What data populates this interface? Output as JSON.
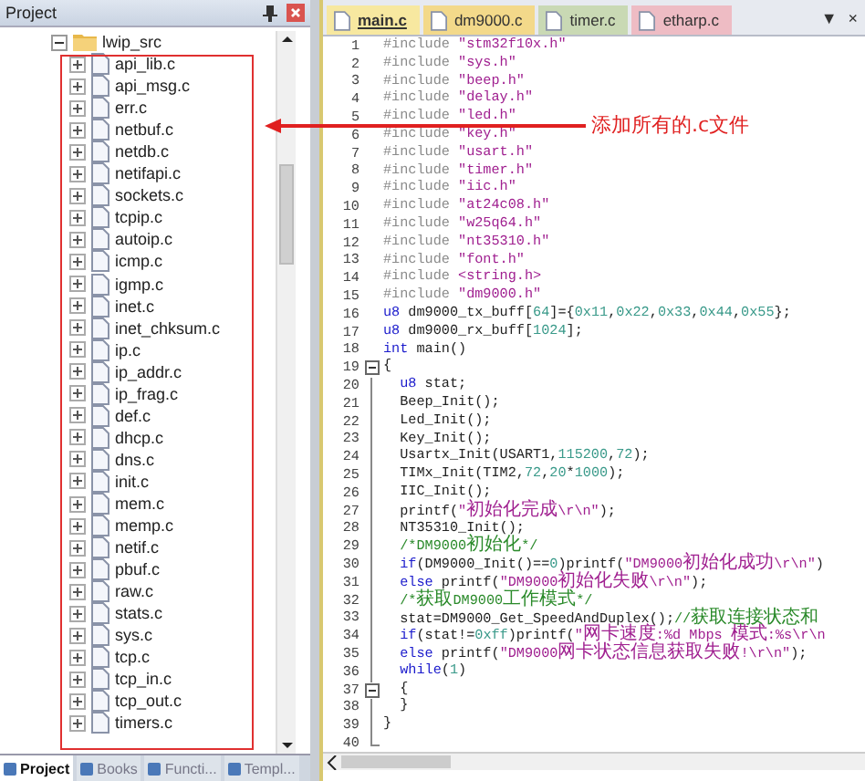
{
  "project_panel": {
    "title": "Project",
    "tree": {
      "label": "lwip_src",
      "expanded": true,
      "children": [
        {
          "label": "api_lib.c"
        },
        {
          "label": "api_msg.c"
        },
        {
          "label": "err.c"
        },
        {
          "label": "netbuf.c"
        },
        {
          "label": "netdb.c"
        },
        {
          "label": "netifapi.c"
        },
        {
          "label": "sockets.c"
        },
        {
          "label": "tcpip.c"
        },
        {
          "label": "autoip.c"
        },
        {
          "label": "icmp.c"
        },
        {
          "label": "igmp.c"
        },
        {
          "label": "inet.c"
        },
        {
          "label": "inet_chksum.c"
        },
        {
          "label": "ip.c"
        },
        {
          "label": "ip_addr.c"
        },
        {
          "label": "ip_frag.c"
        },
        {
          "label": "def.c"
        },
        {
          "label": "dhcp.c"
        },
        {
          "label": "dns.c"
        },
        {
          "label": "init.c"
        },
        {
          "label": "mem.c"
        },
        {
          "label": "memp.c"
        },
        {
          "label": "netif.c"
        },
        {
          "label": "pbuf.c"
        },
        {
          "label": "raw.c"
        },
        {
          "label": "stats.c"
        },
        {
          "label": "sys.c"
        },
        {
          "label": "tcp.c"
        },
        {
          "label": "tcp_in.c"
        },
        {
          "label": "tcp_out.c"
        },
        {
          "label": "timers.c"
        }
      ]
    },
    "bottom_tabs": [
      {
        "label": "Project",
        "selected": true
      },
      {
        "label": "Books",
        "selected": false
      },
      {
        "label": "Functi...",
        "selected": false
      },
      {
        "label": "Templ...",
        "selected": false
      }
    ]
  },
  "annotation": {
    "text": "添加所有的.c文件"
  },
  "editor": {
    "tabs": [
      {
        "label": "main.c",
        "selected": true,
        "color": "#f7e8a0"
      },
      {
        "label": "dm9000.c",
        "selected": false,
        "color": "#f3d98a"
      },
      {
        "label": "timer.c",
        "selected": false,
        "color": "#c9d9b4"
      },
      {
        "label": "etharp.c",
        "selected": false,
        "color": "#eebcc4"
      }
    ],
    "menu_glyph": "▼",
    "close_glyph": "×",
    "lines": [
      {
        "number": "1",
        "tokens": [
          {
            "kind": "directive",
            "text": "#include "
          },
          {
            "kind": "string",
            "text": "\"stm32f10x.h\""
          }
        ]
      },
      {
        "number": "2",
        "tokens": [
          {
            "kind": "directive",
            "text": "#include "
          },
          {
            "kind": "string",
            "text": "\"sys.h\""
          }
        ]
      },
      {
        "number": "3",
        "tokens": [
          {
            "kind": "directive",
            "text": "#include "
          },
          {
            "kind": "string",
            "text": "\"beep.h\""
          }
        ]
      },
      {
        "number": "4",
        "tokens": [
          {
            "kind": "directive",
            "text": "#include "
          },
          {
            "kind": "string",
            "text": "\"delay.h\""
          }
        ]
      },
      {
        "number": "5",
        "tokens": [
          {
            "kind": "directive",
            "text": "#include "
          },
          {
            "kind": "string",
            "text": "\"led.h\""
          }
        ]
      },
      {
        "number": "6",
        "tokens": [
          {
            "kind": "directive",
            "text": "#include "
          },
          {
            "kind": "string",
            "text": "\"key.h\""
          }
        ]
      },
      {
        "number": "7",
        "tokens": [
          {
            "kind": "directive",
            "text": "#include "
          },
          {
            "kind": "string",
            "text": "\"usart.h\""
          }
        ]
      },
      {
        "number": "8",
        "tokens": [
          {
            "kind": "directive",
            "text": "#include "
          },
          {
            "kind": "string",
            "text": "\"timer.h\""
          }
        ]
      },
      {
        "number": "9",
        "tokens": [
          {
            "kind": "directive",
            "text": "#include "
          },
          {
            "kind": "string",
            "text": "\"iic.h\""
          }
        ]
      },
      {
        "number": "10",
        "tokens": [
          {
            "kind": "directive",
            "text": "#include "
          },
          {
            "kind": "string",
            "text": "\"at24c08.h\""
          }
        ]
      },
      {
        "number": "11",
        "tokens": [
          {
            "kind": "directive",
            "text": "#include "
          },
          {
            "kind": "string",
            "text": "\"w25q64.h\""
          }
        ]
      },
      {
        "number": "12",
        "tokens": [
          {
            "kind": "directive",
            "text": "#include "
          },
          {
            "kind": "string",
            "text": "\"nt35310.h\""
          }
        ]
      },
      {
        "number": "13",
        "tokens": [
          {
            "kind": "directive",
            "text": "#include "
          },
          {
            "kind": "string",
            "text": "\"font.h\""
          }
        ]
      },
      {
        "number": "14",
        "tokens": [
          {
            "kind": "directive",
            "text": "#include "
          },
          {
            "kind": "string",
            "text": "<string.h>"
          }
        ]
      },
      {
        "number": "15",
        "tokens": [
          {
            "kind": "directive",
            "text": "#include "
          },
          {
            "kind": "string",
            "text": "\"dm9000.h\""
          }
        ]
      },
      {
        "number": "16",
        "tokens": [
          {
            "kind": "keyword",
            "text": "u8"
          },
          {
            "kind": "plain",
            "text": " dm9000_tx_buff["
          },
          {
            "kind": "number",
            "text": "64"
          },
          {
            "kind": "plain",
            "text": "]={"
          },
          {
            "kind": "number",
            "text": "0x11"
          },
          {
            "kind": "plain",
            "text": ","
          },
          {
            "kind": "number",
            "text": "0x22"
          },
          {
            "kind": "plain",
            "text": ","
          },
          {
            "kind": "number",
            "text": "0x33"
          },
          {
            "kind": "plain",
            "text": ","
          },
          {
            "kind": "number",
            "text": "0x44"
          },
          {
            "kind": "plain",
            "text": ","
          },
          {
            "kind": "number",
            "text": "0x55"
          },
          {
            "kind": "plain",
            "text": "};"
          }
        ]
      },
      {
        "number": "17",
        "tokens": [
          {
            "kind": "keyword",
            "text": "u8"
          },
          {
            "kind": "plain",
            "text": " dm9000_rx_buff["
          },
          {
            "kind": "number",
            "text": "1024"
          },
          {
            "kind": "plain",
            "text": "];"
          }
        ]
      },
      {
        "number": "18",
        "tokens": [
          {
            "kind": "keyword",
            "text": "int"
          },
          {
            "kind": "plain",
            "text": " main()"
          }
        ]
      },
      {
        "number": "19",
        "fold_box": true,
        "tokens": [
          {
            "kind": "plain",
            "text": "{"
          }
        ]
      },
      {
        "number": "20",
        "tokens": [
          {
            "kind": "keyword",
            "text": "  u8"
          },
          {
            "kind": "plain",
            "text": " stat;"
          }
        ]
      },
      {
        "number": "21",
        "tokens": [
          {
            "kind": "plain",
            "text": "  Beep_Init();"
          }
        ]
      },
      {
        "number": "22",
        "tokens": [
          {
            "kind": "plain",
            "text": "  Led_Init();"
          }
        ]
      },
      {
        "number": "23",
        "tokens": [
          {
            "kind": "plain",
            "text": "  Key_Init();"
          }
        ]
      },
      {
        "number": "24",
        "tokens": [
          {
            "kind": "plain",
            "text": "  Usartx_Init(USART1,"
          },
          {
            "kind": "number",
            "text": "115200"
          },
          {
            "kind": "plain",
            "text": ","
          },
          {
            "kind": "number",
            "text": "72"
          },
          {
            "kind": "plain",
            "text": ");"
          }
        ]
      },
      {
        "number": "25",
        "tokens": [
          {
            "kind": "plain",
            "text": "  TIMx_Init(TIM2,"
          },
          {
            "kind": "number",
            "text": "72"
          },
          {
            "kind": "plain",
            "text": ","
          },
          {
            "kind": "number",
            "text": "20"
          },
          {
            "kind": "plain",
            "text": "*"
          },
          {
            "kind": "number",
            "text": "1000"
          },
          {
            "kind": "plain",
            "text": ");"
          }
        ]
      },
      {
        "number": "26",
        "tokens": [
          {
            "kind": "plain",
            "text": "  IIC_Init();"
          }
        ]
      },
      {
        "number": "27",
        "tokens": [
          {
            "kind": "plain",
            "text": "  printf("
          },
          {
            "kind": "string",
            "text": "\"初始化完成\\r\\n\""
          },
          {
            "kind": "plain",
            "text": ");"
          }
        ]
      },
      {
        "number": "28",
        "tokens": [
          {
            "kind": "plain",
            "text": "  NT35310_Init();"
          }
        ]
      },
      {
        "number": "29",
        "tokens": [
          {
            "kind": "comment",
            "text": "  /*DM9000初始化*/"
          }
        ]
      },
      {
        "number": "30",
        "tokens": [
          {
            "kind": "keyword",
            "text": "  if"
          },
          {
            "kind": "plain",
            "text": "(DM9000_Init()=="
          },
          {
            "kind": "number",
            "text": "0"
          },
          {
            "kind": "plain",
            "text": ")printf("
          },
          {
            "kind": "string",
            "text": "\"DM9000初始化成功\\r\\n\""
          },
          {
            "kind": "plain",
            "text": ")"
          }
        ]
      },
      {
        "number": "31",
        "tokens": [
          {
            "kind": "keyword",
            "text": "  else"
          },
          {
            "kind": "plain",
            "text": " printf("
          },
          {
            "kind": "string",
            "text": "\"DM9000初始化失败\\r\\n\""
          },
          {
            "kind": "plain",
            "text": ");"
          }
        ]
      },
      {
        "number": "32",
        "tokens": [
          {
            "kind": "comment",
            "text": "  /*获取DM9000工作模式*/"
          }
        ]
      },
      {
        "number": "33",
        "tokens": [
          {
            "kind": "plain",
            "text": "  stat=DM9000_Get_SpeedAndDuplex();"
          },
          {
            "kind": "comment",
            "text": "//获取连接状态和"
          }
        ]
      },
      {
        "number": "34",
        "tokens": [
          {
            "kind": "keyword",
            "text": "  if"
          },
          {
            "kind": "plain",
            "text": "(stat!="
          },
          {
            "kind": "number",
            "text": "0xff"
          },
          {
            "kind": "plain",
            "text": ")printf("
          },
          {
            "kind": "string",
            "text": "\"网卡速度:%d Mbps 模式:%s\\r\\n"
          }
        ]
      },
      {
        "number": "35",
        "tokens": [
          {
            "kind": "keyword",
            "text": "  else"
          },
          {
            "kind": "plain",
            "text": " printf("
          },
          {
            "kind": "string",
            "text": "\"DM9000网卡状态信息获取失败!\\r\\n\""
          },
          {
            "kind": "plain",
            "text": ");"
          }
        ]
      },
      {
        "number": "36",
        "tokens": [
          {
            "kind": "keyword",
            "text": "  while"
          },
          {
            "kind": "plain",
            "text": "("
          },
          {
            "kind": "number",
            "text": "1"
          },
          {
            "kind": "plain",
            "text": ")"
          }
        ]
      },
      {
        "number": "37",
        "fold_box": true,
        "tokens": [
          {
            "kind": "plain",
            "text": "  {"
          }
        ]
      },
      {
        "number": "38",
        "tokens": [
          {
            "kind": "plain",
            "text": "  }"
          }
        ]
      },
      {
        "number": "39",
        "tokens": [
          {
            "kind": "plain",
            "text": "}"
          }
        ]
      },
      {
        "number": "40"
      }
    ]
  }
}
